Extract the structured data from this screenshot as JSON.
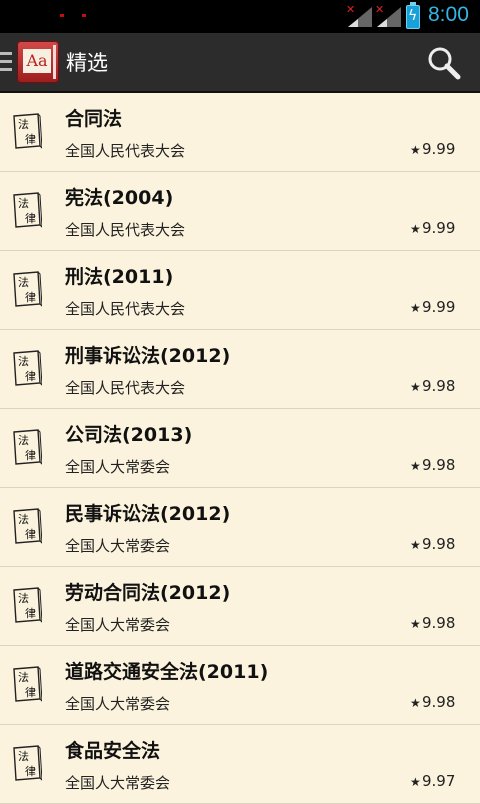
{
  "status_bar": {
    "time": "8:00",
    "icons": [
      "notification-icon",
      "signal-icon",
      "signal-icon",
      "battery-charging-icon"
    ]
  },
  "action_bar": {
    "title": "精选",
    "icons": [
      "menu-icon",
      "app-icon",
      "search-icon"
    ],
    "app_icon_text": "Aa"
  },
  "law_icon_text": [
    "法",
    "律"
  ],
  "items": [
    {
      "name": "合同法",
      "author": "全国人民代表大会",
      "star": "★",
      "score": "9.99"
    },
    {
      "name": "宪法(2004)",
      "author": "全国人民代表大会",
      "star": "★",
      "score": "9.99"
    },
    {
      "name": "刑法(2011)",
      "author": "全国人民代表大会",
      "star": "★",
      "score": "9.99"
    },
    {
      "name": "刑事诉讼法(2012)",
      "author": "全国人民代表大会",
      "star": "★",
      "score": "9.98"
    },
    {
      "name": "公司法(2013)",
      "author": "全国人大常委会",
      "star": "★",
      "score": "9.98"
    },
    {
      "name": "民事诉讼法(2012)",
      "author": "全国人大常委会",
      "star": "★",
      "score": "9.98"
    },
    {
      "name": "劳动合同法(2012)",
      "author": "全国人大常委会",
      "star": "★",
      "score": "9.98"
    },
    {
      "name": "道路交通安全法(2011)",
      "author": "全国人大常委会",
      "star": "★",
      "score": "9.98"
    },
    {
      "name": "食品安全法",
      "author": "全国人大常委会",
      "star": "★",
      "score": "9.97"
    }
  ],
  "colors": {
    "background": "#fbf3de",
    "action_bar": "#2c2c2c",
    "clock": "#33b5e5",
    "app_icon": "#b22222"
  }
}
